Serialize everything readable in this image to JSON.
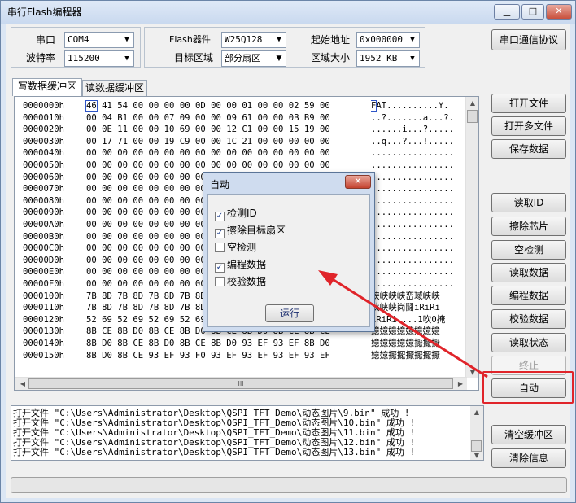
{
  "window": {
    "title": "串行Flash编程器",
    "min_label": "▁",
    "max_label": "□",
    "close_label": "✕"
  },
  "settings": {
    "port_label": "串口",
    "port_value": "COM4",
    "baud_label": "波特率",
    "baud_value": "115200",
    "device_label": "Flash器件",
    "device_value": "W25Q128",
    "target_label": "目标区域",
    "target_value": "部分扇区",
    "start_label": "起始地址",
    "start_value": "0x000000",
    "size_label": "区域大小",
    "size_value": "1952 KB",
    "protocol_button": "串口通信协议"
  },
  "tabs": [
    {
      "label": "写数据缓冲区"
    },
    {
      "label": "读数据缓冲区"
    }
  ],
  "hex": {
    "rows": [
      {
        "addr": "0000000h",
        "bytes": "46 41 54 00 00 00 00 0D 00 00 01 00 00 02 59 00",
        "ascii": "FAT..........Y."
      },
      {
        "addr": "0000010h",
        "bytes": "00 04 B1 00 00 07 09 00 00 09 61 00 00 0B B9 00",
        "ascii": "..?.......a...?."
      },
      {
        "addr": "0000020h",
        "bytes": "00 0E 11 00 00 10 69 00 00 12 C1 00 00 15 19 00",
        "ascii": "......i...?....."
      },
      {
        "addr": "0000030h",
        "bytes": "00 17 71 00 00 19 C9 00 00 1C 21 00 00 00 00 00",
        "ascii": "..q...?...!....."
      },
      {
        "addr": "0000040h",
        "bytes": "00 00 00 00 00 00 00 00 00 00 00 00 00 00 00 00",
        "ascii": "................"
      },
      {
        "addr": "0000050h",
        "bytes": "00 00 00 00 00 00 00 00 00 00 00 00 00 00 00 00",
        "ascii": "................"
      },
      {
        "addr": "0000060h",
        "bytes": "00 00 00 00 00 00 00 00 00 00 00 00 00 00 00 00",
        "ascii": "................"
      },
      {
        "addr": "0000070h",
        "bytes": "00 00 00 00 00 00 00 00 00 00 00 00 00 00 00 00",
        "ascii": "................"
      },
      {
        "addr": "0000080h",
        "bytes": "00 00 00 00 00 00 00 00 00 00 00 00 00 00 00 00",
        "ascii": "................"
      },
      {
        "addr": "0000090h",
        "bytes": "00 00 00 00 00 00 00 00 00 00 00 00 00 00 00 00",
        "ascii": "................"
      },
      {
        "addr": "00000A0h",
        "bytes": "00 00 00 00 00 00 00 00 00 00 00 00 00 00 00 00",
        "ascii": "................"
      },
      {
        "addr": "00000B0h",
        "bytes": "00 00 00 00 00 00 00 00 00 00 00 00 00 00 00 00",
        "ascii": "................"
      },
      {
        "addr": "00000C0h",
        "bytes": "00 00 00 00 00 00 00 00 00 00 00 00 00 00 00 00",
        "ascii": "................"
      },
      {
        "addr": "00000D0h",
        "bytes": "00 00 00 00 00 00 00 00 00 00 00 00 00 00 00 00",
        "ascii": "................"
      },
      {
        "addr": "00000E0h",
        "bytes": "00 00 00 00 00 00 00 00 00 00 00 00 00 00 00 00",
        "ascii": "................"
      },
      {
        "addr": "00000F0h",
        "bytes": "00 00 00 00 00 00 00 00 00 00 00 00 00 00 00 00",
        "ascii": "................"
      },
      {
        "addr": "0000100h",
        "bytes": "7B 8D 7B 8D 7B 8D 7B 8D 7B 8D 7B 8D 7B 8D 7B 8D",
        "ascii": "峡峡峡峡峦琙峡峡"
      },
      {
        "addr": "0000110h",
        "bytes": "7B 8D 7B 8D 7B 8D 7B 8D 7B 8D 7B 8D 7B 8D 7B 8D",
        "ascii": "峡峡峡岗鬪iRiRi"
      },
      {
        "addr": "0000120h",
        "bytes": "52 69 52 69 52 69 52 69 52 69 52 69 52 69 52 69",
        "ascii": "iRiRi....1吹0掩"
      },
      {
        "addr": "0000130h",
        "bytes": "8B CE 8B D0 8B CE 8B D0 8B CE 8B D0 8B CE 8B CE",
        "ascii": "嬑嬑嬑嬑嬑嬑嬑嬑"
      },
      {
        "addr": "0000140h",
        "bytes": "8B D0 8B CE 8B D0 8B CE 8B D0 93 EF 93 EF 8B D0",
        "ascii": "嬑嬑嬑嬑嬑擫擫擫"
      },
      {
        "addr": "0000150h",
        "bytes": "8B D0 8B CE 93 EF 93 F0 93 EF 93 EF 93 EF 93 EF",
        "ascii": "嬑嬑擫擫擫擫擫擫"
      }
    ],
    "hscroll_label": "III"
  },
  "buttons": {
    "open_file": "打开文件",
    "open_multi": "打开多文件",
    "save_data": "保存数据",
    "read_id": "读取ID",
    "erase_chip": "擦除芯片",
    "blank_check": "空检测",
    "read_data": "读取数据",
    "program_data": "编程数据",
    "verify_data": "校验数据",
    "read_status": "读取状态",
    "stop": "终止",
    "auto": "自动",
    "clear_buffer": "清空缓冲区",
    "clear_info": "清除信息"
  },
  "log": {
    "lines": [
      "打开文件 \"C:\\Users\\Administrator\\Desktop\\QSPI_TFT_Demo\\动态图片\\9.bin\" 成功 !",
      "打开文件 \"C:\\Users\\Administrator\\Desktop\\QSPI_TFT_Demo\\动态图片\\10.bin\" 成功 !",
      "打开文件 \"C:\\Users\\Administrator\\Desktop\\QSPI_TFT_Demo\\动态图片\\11.bin\" 成功 !",
      "打开文件 \"C:\\Users\\Administrator\\Desktop\\QSPI_TFT_Demo\\动态图片\\12.bin\" 成功 !",
      "打开文件 \"C:\\Users\\Administrator\\Desktop\\QSPI_TFT_Demo\\动态图片\\13.bin\" 成功 !"
    ]
  },
  "dialog": {
    "title": "自动",
    "close_label": "✕",
    "options": [
      {
        "label": "检测ID",
        "checked": true
      },
      {
        "label": "擦除目标扇区",
        "checked": true
      },
      {
        "label": "空检测",
        "checked": false
      },
      {
        "label": "编程数据",
        "checked": true
      },
      {
        "label": "校验数据",
        "checked": false
      }
    ],
    "run_button": "运行"
  },
  "colors": {
    "annotation_red": "#e0242a",
    "hex_cursor": "#2e55c7"
  }
}
